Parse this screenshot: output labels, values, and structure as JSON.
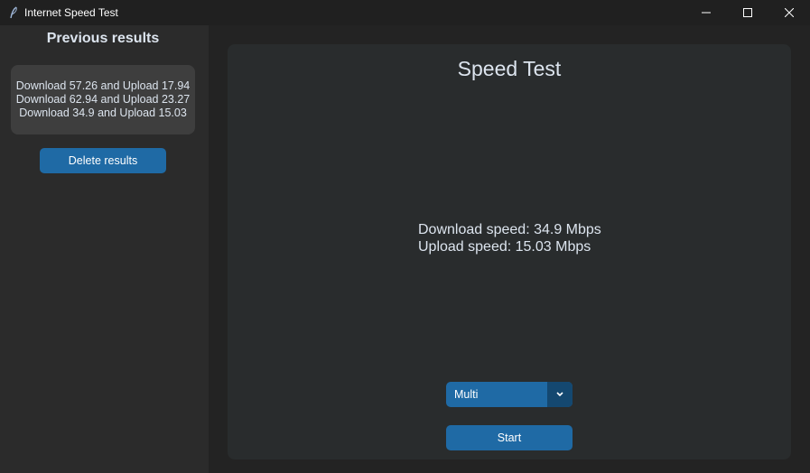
{
  "window": {
    "title": "Internet Speed Test",
    "icons": [
      "feather-icon",
      "minimize-icon",
      "maximize-icon",
      "close-icon"
    ]
  },
  "sidebar": {
    "title": "Previous results",
    "results": [
      "Download 57.26 and Upload 17.94",
      "Download 62.94 and Upload 23.27",
      "Download 34.9 and Upload 15.03"
    ],
    "delete_label": "Delete results"
  },
  "main": {
    "title": "Speed Test",
    "download_text": "Download speed: 34.9 Mbps",
    "upload_text": "Upload speed: 15.03 Mbps",
    "mode_selected": "Multi",
    "start_label": "Start"
  },
  "colors": {
    "accent": "#1f6aa5",
    "accent_dark": "#144870",
    "sidebar_bg": "#2b2b2b",
    "panel_bg": "#292c2d",
    "text": "#dce4ee"
  }
}
